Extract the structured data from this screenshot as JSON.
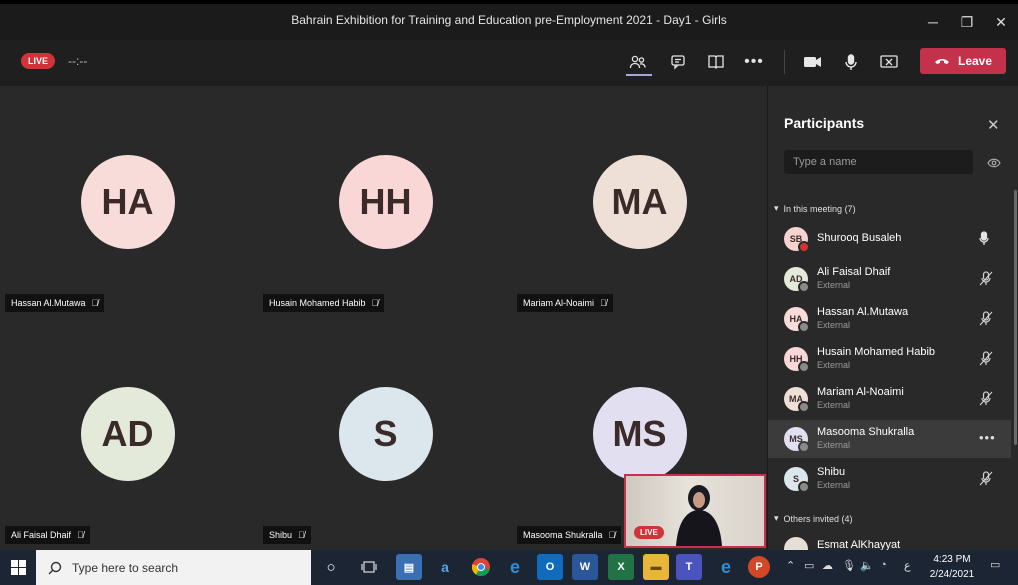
{
  "window": {
    "title": "Bahrain Exhibition for Training and Education pre-Employment 2021 - Day1 - Girls",
    "minimize_glyph": "─",
    "restore_glyph": "❐",
    "close_glyph": "✕"
  },
  "toolbar": {
    "live_badge": "LIVE",
    "timer": "--:--",
    "leave_label": "Leave",
    "icons": [
      "participants-icon",
      "chat-icon",
      "share-tray-icon",
      "more-icon",
      "camera-icon",
      "mic-icon",
      "share-screen-icon"
    ]
  },
  "tiles": [
    {
      "initials": "HA",
      "name": "Hassan Al.Mutawa",
      "color": "#f8dcd9"
    },
    {
      "initials": "HH",
      "name": "Husain Mohamed Habib",
      "color": "#f8d7d6"
    },
    {
      "initials": "MA",
      "name": "Mariam Al-Noaimi",
      "color": "#eee0d6"
    },
    {
      "initials": "AD",
      "name": "Ali Faisal Dhaif",
      "color": "#e4ead9"
    },
    {
      "initials": "S",
      "name": "Shibu",
      "color": "#dbe7ec"
    },
    {
      "initials": "MS",
      "name": "Masooma Shukralla",
      "color": "#e1dff0"
    }
  ],
  "self_view": {
    "live_badge": "LIVE"
  },
  "panel": {
    "title": "Participants",
    "search_placeholder": "Type a name",
    "section_in_meeting": "In this meeting (7)",
    "section_invited": "Others invited (4)",
    "participants": [
      {
        "initials": "SB",
        "name": "Shurooq Busaleh",
        "sub": "",
        "color": "#f6d3cf",
        "status": "red",
        "mic": "on"
      },
      {
        "initials": "AD",
        "name": "Ali Faisal Dhaif",
        "sub": "External",
        "color": "#e4ead9",
        "status": "gray",
        "mic": "muted"
      },
      {
        "initials": "HA",
        "name": "Hassan Al.Mutawa",
        "sub": "External",
        "color": "#f8dcd9",
        "status": "gray",
        "mic": "muted"
      },
      {
        "initials": "HH",
        "name": "Husain Mohamed Habib",
        "sub": "External",
        "color": "#f8d7d6",
        "status": "gray",
        "mic": "muted"
      },
      {
        "initials": "MA",
        "name": "Mariam Al-Noaimi",
        "sub": "External",
        "color": "#eee0d6",
        "status": "gray",
        "mic": "muted"
      },
      {
        "initials": "MS",
        "name": "Masooma Shukralla",
        "sub": "External",
        "color": "#e1dff0",
        "status": "gray",
        "mic": "more"
      },
      {
        "initials": "S",
        "name": "Shibu",
        "sub": "External",
        "color": "#dbe7ec",
        "status": "gray",
        "mic": "muted"
      }
    ],
    "invited": [
      {
        "initials": "",
        "name": "Esmat AlKhayyat",
        "color": "#e6dfd8"
      }
    ]
  },
  "taskbar": {
    "search_placeholder": "Type here to search",
    "clock_time": "4:23 PM",
    "clock_date": "2/24/2021"
  }
}
